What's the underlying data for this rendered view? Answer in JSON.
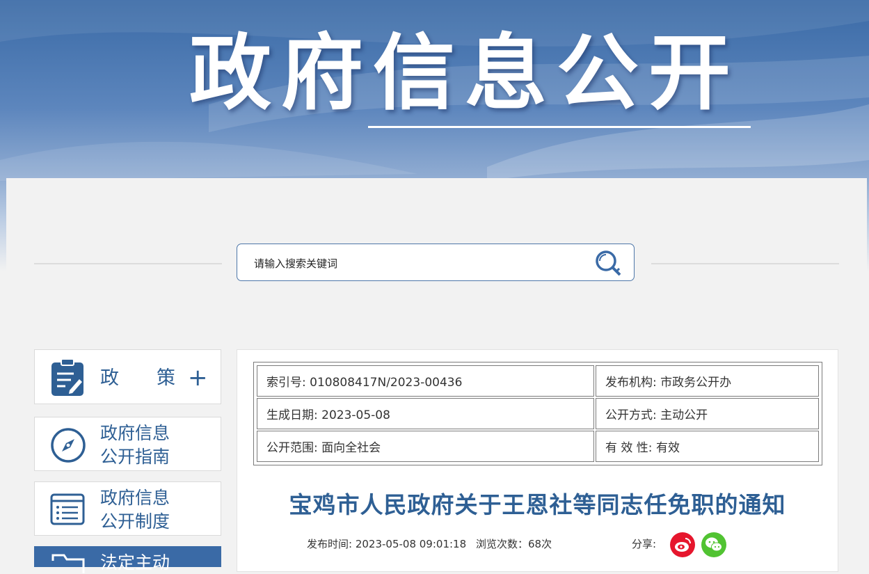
{
  "banner": {
    "title": "政府信息公开"
  },
  "search": {
    "placeholder": "请输入搜索关键词"
  },
  "sidebar": {
    "items": [
      {
        "label": "政　　策",
        "icon": "clipboard-icon",
        "expand": "+"
      },
      {
        "label_line1": "政府信息",
        "label_line2": "公开指南",
        "icon": "compass-icon"
      },
      {
        "label_line1": "政府信息",
        "label_line2": "公开制度",
        "icon": "document-list-icon"
      },
      {
        "label": "法定主动",
        "icon": "folder-icon"
      }
    ]
  },
  "doc": {
    "info": {
      "index_no": "索引号: 010808417N/2023-00436",
      "publisher": "发布机构: 市政务公开办",
      "created": "生成日期: 2023-05-08",
      "method": "公开方式: 主动公开",
      "scope": "公开范围: 面向全社会",
      "validity": "有 效 性:  有效"
    },
    "title": "宝鸡市人民政府关于王恩社等同志任免职的通知",
    "publish_time": "发布时间: 2023-05-08 09:01:18",
    "views": "浏览次数：68次",
    "share_label": "分享:"
  },
  "colors": {
    "accent": "#2e5f94",
    "banner": "#3a6aa6",
    "weibo": "#e6162d",
    "wechat": "#51c332"
  }
}
